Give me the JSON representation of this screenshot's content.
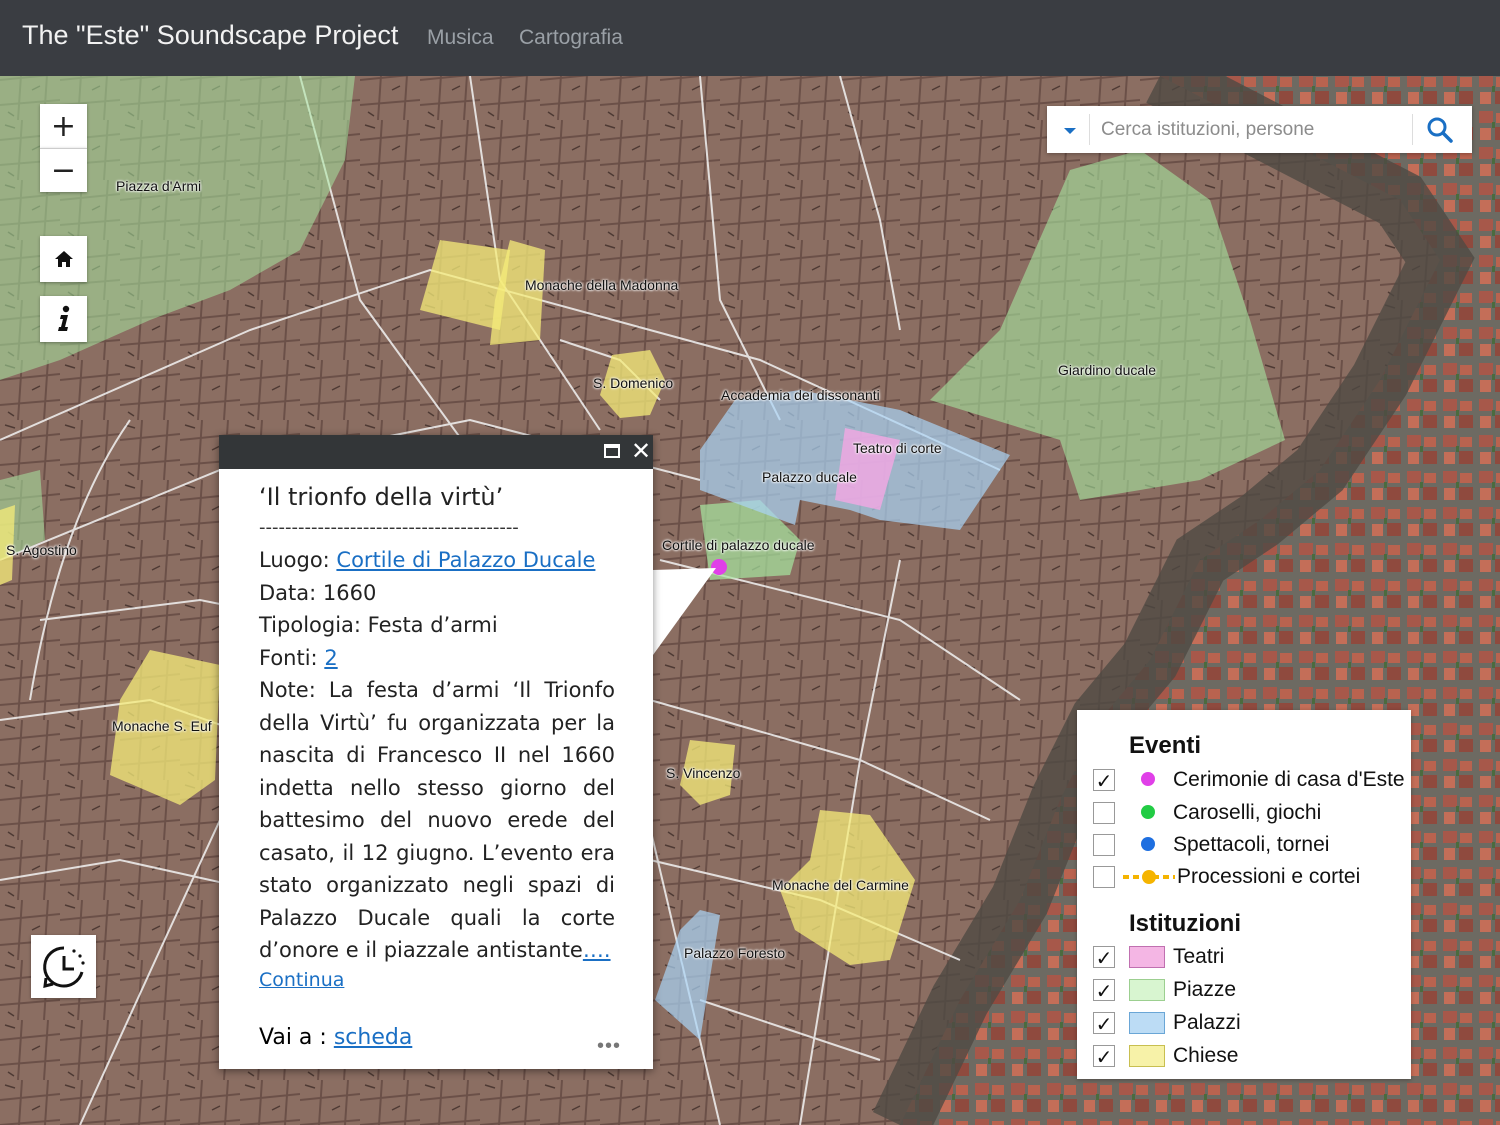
{
  "header": {
    "brand": "The \"Este\" Soundscape Project",
    "nav": [
      "Musica",
      "Cartografia"
    ]
  },
  "search": {
    "placeholder": "Cerca istituzioni, persone"
  },
  "map": {
    "places": [
      {
        "name": "Piazza d'Armi",
        "key": "piazza-d-armi"
      },
      {
        "name": "Monache della Madonna",
        "key": "monache-della-madonna"
      },
      {
        "name": "S. Domenico",
        "key": "s-domenico"
      },
      {
        "name": "Accademia dei dissonanti",
        "key": "accademia-dei-dissonanti"
      },
      {
        "name": "Teatro di corte",
        "key": "teatro-di-corte"
      },
      {
        "name": "Palazzo ducale",
        "key": "palazzo-ducale"
      },
      {
        "name": "Giardino ducale",
        "key": "giardino-ducale"
      },
      {
        "name": "Cortile di palazzo ducale",
        "key": "cortile-di-palazzo-ducale"
      },
      {
        "name": "S. Agostino",
        "key": "s-agostino"
      },
      {
        "name": "Monache S. Euf",
        "key": "monache-s-euf"
      },
      {
        "name": "S. Vincenzo",
        "key": "s-vincenzo"
      },
      {
        "name": "Monache del Carmine",
        "key": "monache-del-carmine"
      },
      {
        "name": "Palazzo Foresto",
        "key": "palazzo-foresto"
      }
    ],
    "event_marker_color": "#e040e8"
  },
  "popup": {
    "title": "‘Il trionfo della virtù’",
    "separator": "----------------------------------------",
    "luogo_label": "Luogo: ",
    "luogo_link": "Cortile di Palazzo Ducale",
    "data": "Data: 1660",
    "tipologia": "Tipologia: Festa d’armi",
    "fonti_label": "Fonti: ",
    "fonti_link": "2",
    "note": "Note: La festa d’armi ‘Il Trionfo della Virtù’ fu organizzata per la nascita di Francesco II nel 1660 indetta nello stesso giorno del battesimo del nuovo erede del casato, il 12 giugno.  L’evento era stato organizzato negli spazi di Palazzo Ducale quali la corte d’onore e il piazzale antistante",
    "note_more": "….",
    "continua": "Continua",
    "vai_label": "Vai a : ",
    "vai_link": "scheda",
    "more": "•••"
  },
  "legend": {
    "eventi_title": "Eventi",
    "eventi": [
      {
        "label": "Cerimonie di casa d'Este",
        "checked": true,
        "color": "#e040e8"
      },
      {
        "label": "Caroselli, giochi",
        "checked": false,
        "color": "#22cc44"
      },
      {
        "label": "Spettacoli, tornei",
        "checked": false,
        "color": "#1e6fe0"
      },
      {
        "label": "Processioni e cortei",
        "checked": false,
        "color": "#f5b400"
      }
    ],
    "istituzioni_title": "Istituzioni",
    "istituzioni": [
      {
        "label": "Teatri",
        "checked": true,
        "color": "#f4b6e4"
      },
      {
        "label": "Piazze",
        "checked": true,
        "color": "#d8f5d0"
      },
      {
        "label": "Palazzi",
        "checked": true,
        "color": "#bcdcf5"
      },
      {
        "label": "Chiese",
        "checked": true,
        "color": "#f7f2a8"
      }
    ],
    "checkmark": "✓"
  }
}
